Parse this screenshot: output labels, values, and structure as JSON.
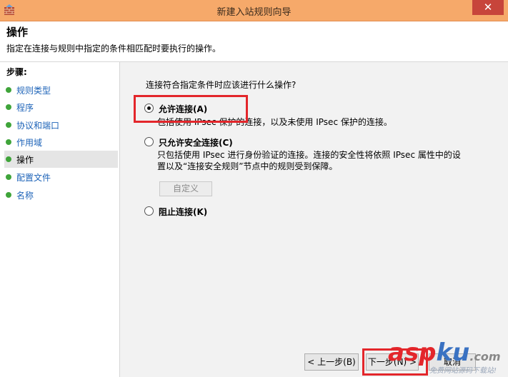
{
  "window": {
    "title": "新建入站规则向导",
    "close_glyph": "✕",
    "icon": "firewall-rule-icon"
  },
  "header": {
    "title": "操作",
    "description": "指定在连接与规则中指定的条件相匹配时要执行的操作。"
  },
  "sidebar": {
    "title": "步骤:",
    "active_index": 4,
    "items": [
      {
        "label": "规则类型"
      },
      {
        "label": "程序"
      },
      {
        "label": "协议和端口"
      },
      {
        "label": "作用域"
      },
      {
        "label": "操作"
      },
      {
        "label": "配置文件"
      },
      {
        "label": "名称"
      }
    ]
  },
  "main": {
    "question": "连接符合指定条件时应该进行什么操作?",
    "options": [
      {
        "label": "允许连接(A)",
        "description": [
          "包括使用 IPsec 保护的连接，以及未使用 IPsec 保护的连接。"
        ],
        "selected": true
      },
      {
        "label": "只允许安全连接(C)",
        "description": [
          "只包括使用 IPsec 进行身份验证的连接。连接的安全性将依照 IPsec 属性中的设",
          "置以及“连接安全规则”节点中的规则受到保障。"
        ],
        "selected": false
      },
      {
        "label": "阻止连接(K)",
        "description": [],
        "selected": false
      }
    ],
    "customize_button": "自定义"
  },
  "footer": {
    "back_button": "< 上一步(B)",
    "next_button": "下一步(N) >",
    "cancel_button": "取消"
  },
  "watermark": {
    "brand_red": "asp",
    "brand_blue": "ku",
    "brand_suffix": ".com",
    "tagline": "免费网站源码下载站!"
  },
  "colors": {
    "titlebar": "#f6a96a",
    "close_button": "#c7453b",
    "link_blue": "#1d63b8",
    "step_dot": "#3fa43a",
    "highlight_red": "#e3262b"
  }
}
